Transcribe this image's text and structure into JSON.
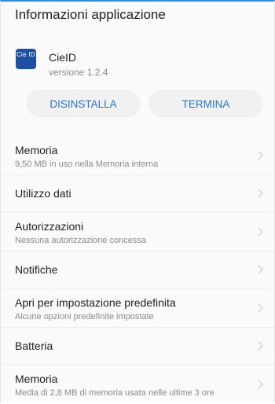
{
  "header": {
    "title": "Informazioni applicazione"
  },
  "app": {
    "icon_text": "Cie ID",
    "name": "CieID",
    "version": "versione 1.2.4",
    "icon_color": "#1f4fa0"
  },
  "actions": {
    "uninstall_label": "DISINSTALLA",
    "stop_label": "TERMINA",
    "accent": "#2a74d4"
  },
  "settings": {
    "items": [
      {
        "label": "Memoria",
        "sub": "9,50 MB in uso nella Memoria interna"
      },
      {
        "label": "Utilizzo dati",
        "sub": ""
      },
      {
        "label": "Autorizzazioni",
        "sub": "Nessuna autorizzazione concessa"
      },
      {
        "label": "Notifiche",
        "sub": ""
      },
      {
        "label": "Apri per impostazione predefinita",
        "sub": "Alcune opzioni predefinite impostate"
      },
      {
        "label": "Batteria",
        "sub": ""
      },
      {
        "label": "Memoria",
        "sub": "Media di 2,8 MB di memoria usata nelle ultime 3 ore"
      }
    ]
  }
}
